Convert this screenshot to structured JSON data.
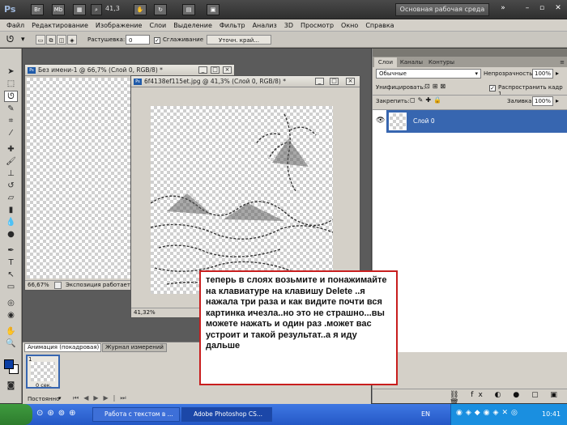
{
  "app": {
    "logo": "Ps",
    "zoom": "41,3",
    "workspace_button": "Основная рабочая среда",
    "topbar_buttons": [
      "Br",
      "Mb"
    ]
  },
  "menu": [
    "Файл",
    "Редактирование",
    "Изображение",
    "Слои",
    "Выделение",
    "Фильтр",
    "Анализ",
    "3D",
    "Просмотр",
    "Окно",
    "Справка"
  ],
  "options": {
    "feather_label": "Растушевка:",
    "feather_value": "0 пикс",
    "antialias_label": "Сглаживание",
    "refine_button": "Уточн. край..."
  },
  "doc1": {
    "title": "Без имени-1 @ 66,7% (Слой 0, RGB/8) *",
    "zoom": "66,67%",
    "status": "Экспозиция работает т"
  },
  "doc2": {
    "title": "6f4138ef115et.jpg @ 41,3% (Слой 0, RGB/8) *",
    "zoom": "41,32%"
  },
  "layers_panel": {
    "tabs": [
      "Слои",
      "Каналы",
      "Контуры"
    ],
    "blend_mode": "Обычные",
    "opacity_label": "Непрозрачность:",
    "opacity_value": "100%",
    "unify_label": "Унифицировать:",
    "propagate_label": "Распространить кадр 1",
    "lock_label": "Закрепить:",
    "fill_label": "Заливка:",
    "fill_value": "100%",
    "layer_name": "Слой 0"
  },
  "animation_panel": {
    "tabs": [
      "Анимация (покадровая)",
      "Журнал измерений"
    ],
    "frame_number": "1",
    "frame_delay": "0 сек.",
    "loop": "Постоянно"
  },
  "annotation": "теперь в слоях возьмите и понажимайте  на клавиатуре на клавишу  Delete ..я нажала три раза и как видите почти вся картинка ичезла..но это не страшно...вы можете нажать и один раз .может вас устроит и такой результат..а я иду дальше",
  "taskbar": {
    "tasks": [
      "Работа с текстом в ...",
      "Adobe Photoshop CS..."
    ],
    "lang": "EN",
    "time": "10:41"
  }
}
